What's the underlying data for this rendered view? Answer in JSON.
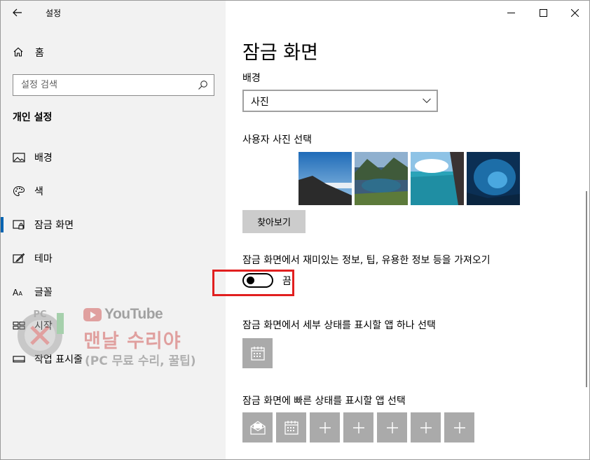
{
  "app": {
    "title": "설정"
  },
  "sidebar": {
    "home_label": "홈",
    "search_placeholder": "설정 검색",
    "section_header": "개인 설정",
    "items": [
      {
        "label": "배경",
        "icon": "picture-icon"
      },
      {
        "label": "색",
        "icon": "palette-icon"
      },
      {
        "label": "잠금 화면",
        "icon": "lock-screen-icon",
        "active": true
      },
      {
        "label": "테마",
        "icon": "theme-brush-icon"
      },
      {
        "label": "글꼴",
        "icon": "font-icon"
      },
      {
        "label": "시작",
        "icon": "start-grid-icon"
      },
      {
        "label": "작업 표시줄",
        "icon": "taskbar-icon"
      }
    ],
    "accent_color": "#0063b1"
  },
  "watermark": {
    "youtube_text": "YouTube",
    "channel_title": "맨날 수리야",
    "subtitle": "(PC 무료 수리, 꿀팁)"
  },
  "main": {
    "page_title": "잠금 화면",
    "background_label": "배경",
    "background_value": "사진",
    "choose_photo_label": "사용자 사진 선택",
    "browse_button": "찾아보기",
    "fun_facts_label": "잠금 화면에서 재미있는 정보, 팁, 유용한 정보 등을 가져오기",
    "fun_facts_toggle_state": "끔",
    "fun_facts_enabled": false,
    "detailed_status_label": "잠금 화면에서 세부 상태를 표시할 앱 하나 선택",
    "quick_status_label": "잠금 화면에 빠른 상태를 표시할 앱 선택",
    "highlight_color": "#e11f1f"
  }
}
